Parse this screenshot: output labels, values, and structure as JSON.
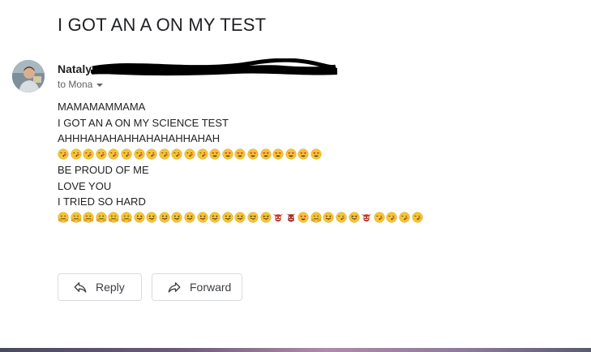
{
  "email": {
    "subject": "I GOT AN A ON MY TEST",
    "sender_name": "Nataly",
    "recipient_line": "to Mona",
    "body_lines": [
      "MAMAMAMMAMA",
      "I GOT AN A ON MY SCIENCE TEST",
      "AHHHAHAHAHHAHAHAHHAHAH",
      "BE PROUD OF ME",
      "LOVE YOU",
      "I TRIED SO HARD"
    ]
  },
  "emoji_rows": {
    "row1": [
      "kiss",
      "kiss",
      "kiss",
      "kiss",
      "kiss",
      "kiss",
      "kiss",
      "kiss",
      "kiss",
      "kiss",
      "kiss",
      "kiss",
      "hearteyes",
      "hearteyes",
      "hearteyes",
      "hearteyes",
      "hearteyes",
      "hearteyes",
      "hearteyes",
      "hearteyes",
      "hearteyes"
    ],
    "row2": [
      "hug",
      "hug",
      "hug",
      "hug",
      "hug",
      "hug",
      "tongue",
      "tongue",
      "tongue",
      "tongue",
      "tongue",
      "tongue",
      "tongue",
      "tongue",
      "tongue",
      "squint",
      "squint",
      "goblin",
      "ogre",
      "hearteyes",
      "hug",
      "tongue",
      "kiss",
      "squint",
      "goblin",
      "kiss",
      "kiss",
      "kiss",
      "kiss"
    ]
  },
  "actions": {
    "reply_label": "Reply",
    "forward_label": "Forward"
  },
  "colors": {
    "emoji_face": "#f7c531",
    "heart": "#e0245e",
    "goblin": "#c0392b",
    "text_primary": "#202124",
    "text_secondary": "#5f6368"
  }
}
